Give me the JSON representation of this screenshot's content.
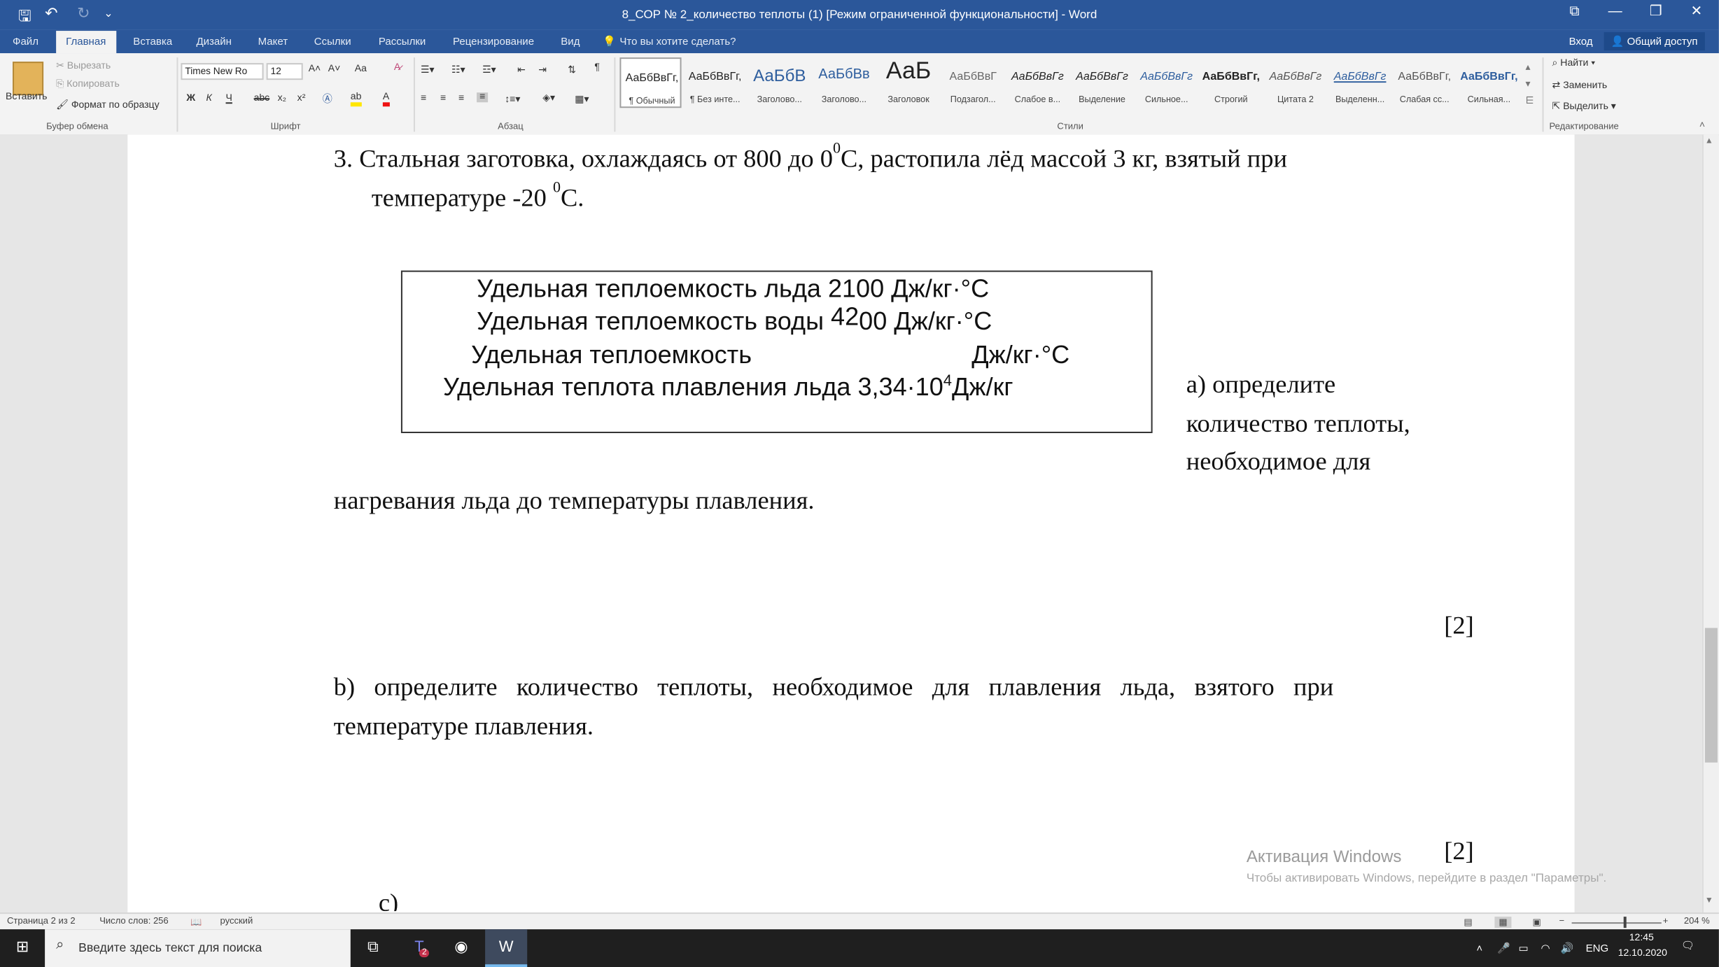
{
  "window": {
    "title": "8_СОР № 2_количество теплоты (1) [Режим ограниченной функциональности] - Word",
    "qat_save": "🖫",
    "qat_undo": "↶",
    "qat_redo": "↻",
    "qat_customize": "⌄",
    "btn_ribbon_opts": "⧉",
    "btn_min": "—",
    "btn_max": "❐",
    "btn_close": "✕"
  },
  "tabs": {
    "file": "Файл",
    "home": "Главная",
    "insert": "Вставка",
    "design": "Дизайн",
    "layout": "Макет",
    "references": "Ссылки",
    "mailings": "Рассылки",
    "review": "Рецензирование",
    "view": "Вид",
    "tell_me": "Что вы хотите сделать?",
    "login": "Вход",
    "share": "Общий доступ"
  },
  "ribbon": {
    "clipboard": {
      "paste": "Вставить",
      "cut": "Вырезать",
      "copy": "Копировать",
      "format_painter": "Формат по образцу",
      "label": "Буфер обмена"
    },
    "font": {
      "name": "Times New Ro",
      "size": "12",
      "bold": "Ж",
      "italic": "К",
      "underline": "Ч",
      "strike": "abc",
      "subscript": "x₂",
      "superscript": "x²",
      "grow": "A˄",
      "shrink": "A˅",
      "case": "Aa",
      "label": "Шрифт"
    },
    "paragraph": {
      "label": "Абзац",
      "pilcrow": "¶"
    },
    "styles": {
      "label": "Стили",
      "items": [
        {
          "preview": "АаБбВвГг,",
          "name": "¶ Обычный"
        },
        {
          "preview": "АаБбВвГг,",
          "name": "¶ Без инте..."
        },
        {
          "preview": "АаБбВ",
          "name": "Заголово..."
        },
        {
          "preview": "АаБбВв",
          "name": "Заголово..."
        },
        {
          "preview": "АаБ",
          "name": "Заголовок"
        },
        {
          "preview": "АаБбВвГ",
          "name": "Подзагол..."
        },
        {
          "preview": "АаБбВвГг",
          "name": "Слабое в..."
        },
        {
          "preview": "АаБбВвГг",
          "name": "Выделение"
        },
        {
          "preview": "АаБбВвГг",
          "name": "Сильное..."
        },
        {
          "preview": "АаБбВвГг,",
          "name": "Строгий"
        },
        {
          "preview": "АаБбВвГг",
          "name": "Цитата 2"
        },
        {
          "preview": "АаБбВвГг",
          "name": "Выделенн..."
        },
        {
          "preview": "АаБбВвГг,",
          "name": "Слабая сс..."
        },
        {
          "preview": "АаБбВвГг,",
          "name": "Сильная..."
        }
      ]
    },
    "editing": {
      "find": "Найти",
      "replace": "Заменить",
      "select": "Выделить",
      "label": "Редактирование"
    }
  },
  "document": {
    "q3_line1_a": "3. Стальная заготовка, охлаждаясь от 800 до 0",
    "q3_line1_sup": "0",
    "q3_line1_b": "С, растопила лёд массой 3 кг, взятый при",
    "q3_line2_a": "температуре  -20 ",
    "q3_line2_sup": "0",
    "q3_line2_b": "С.",
    "table_row1": "Удельная теплоемкость льда 2100 Дж/кг·°С",
    "table_row2_a": "Удельная теплоемкость воды",
    "table_row2_num": "42",
    "table_row2_b": "00 Дж/кг·°С",
    "table_row3_a": "Удельная теплоемкость",
    "table_row3_b": "Дж/кг·°С",
    "table_row4_a": "Удельная теплота плавления льда 3,34·10",
    "table_row4_sup": "4",
    "table_row4_b": "Дж/кг",
    "qa_line1": "а) определите",
    "qa_line2": "количество теплоты,",
    "qa_line3": "необходимое для",
    "qa_line4": "нагревания льда до температуры плавления.",
    "mark_a": "[2]",
    "qb_line1": "b)   определите   количество   теплоты,   необходимое   для   плавления   льда,   взятого   при",
    "qb_line2": "температуре плавления.",
    "mark_b": "[2]",
    "next_item": "с)"
  },
  "watermark": {
    "title": "Активация Windows",
    "subtitle": "Чтобы активировать Windows, перейдите в раздел \"Параметры\"."
  },
  "statusbar": {
    "page": "Страница 2 из 2",
    "words": "Число слов: 256",
    "language": "русский",
    "zoom": "204 %"
  },
  "taskbar": {
    "search_placeholder": "Введите здесь текст для поиска",
    "lang": "ENG",
    "time": "12:45",
    "date": "12.10.2020",
    "teams_badge": "2"
  }
}
